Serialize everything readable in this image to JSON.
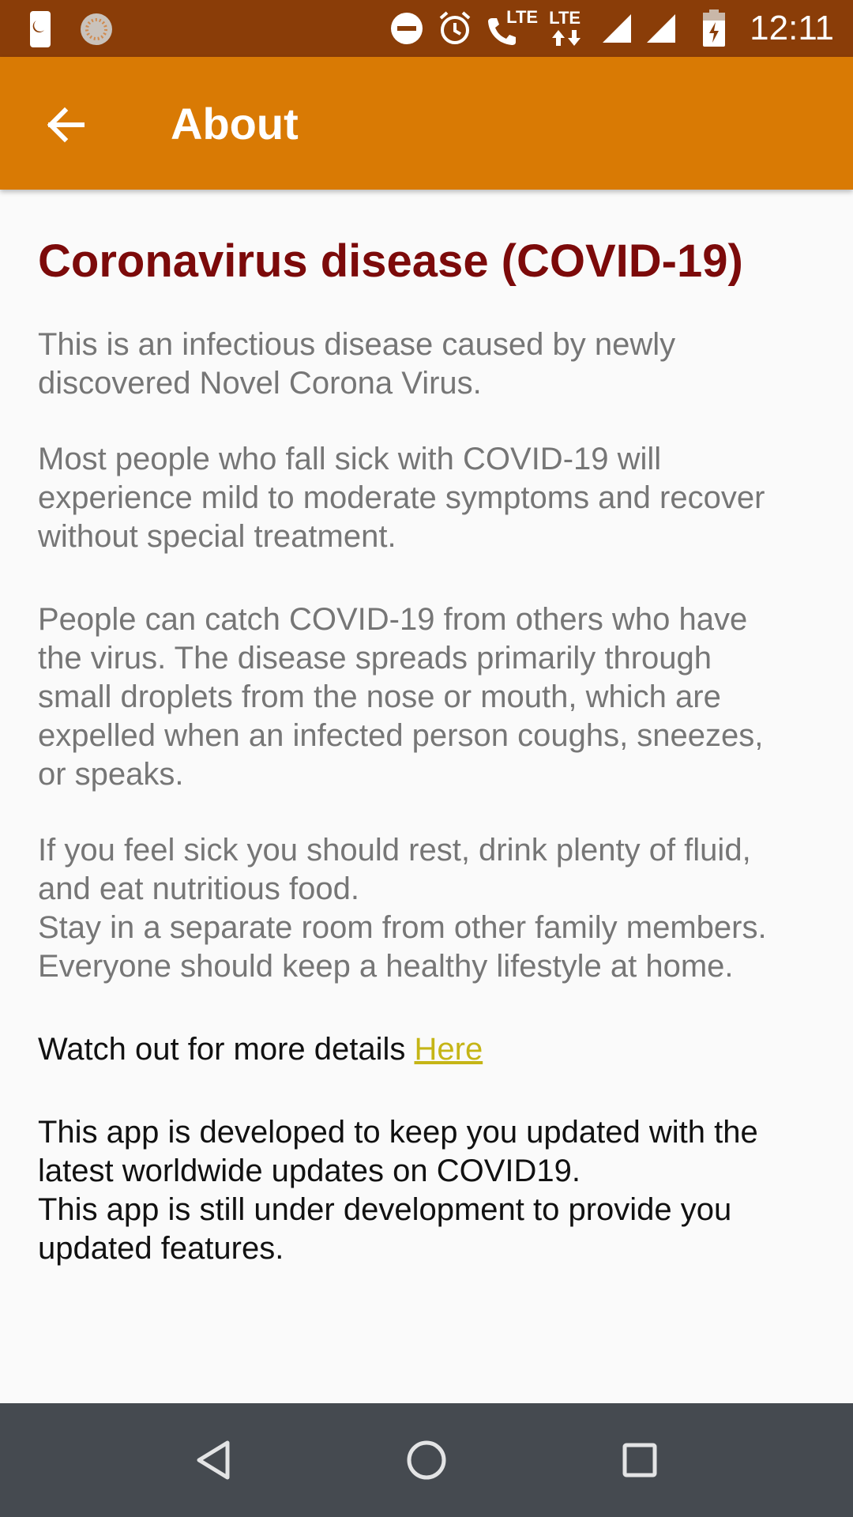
{
  "status_bar": {
    "time": "12:11",
    "lte_1": "LTE",
    "lte_2": "LTE",
    "icons": [
      "sim-icon",
      "app-icon",
      "do-not-disturb-icon",
      "alarm-icon",
      "call-icon",
      "signal-icon",
      "battery-icon"
    ]
  },
  "app_bar": {
    "title": "About",
    "back_icon": "arrow-back-icon",
    "color": "#d97a04"
  },
  "content": {
    "heading": "Coronavirus disease (COVID-19)",
    "p1": "This is an infectious disease caused by newly\ndiscovered Novel Corona Virus.",
    "p2": "Most people who fall sick with COVID-19 will\nexperience mild to moderate symptoms and recover\nwithout special treatment.",
    "p3": "People can catch COVID-19 from others who have\nthe virus. The disease spreads primarily through\nsmall droplets from the nose or mouth, which are\nexpelled when an infected person coughs, sneezes,\nor speaks.",
    "p4": "If you feel sick you should rest, drink plenty of fluid,\nand eat nutritious food.\nStay in a separate room from other family members.\nEveryone should keep a healthy lifestyle at home.",
    "watch_text": "Watch out for more details ",
    "watch_link": "Here",
    "p5": "This app is developed to keep you updated with the\nlatest worldwide updates on COVID19.\nThis app is still under development to provide you\nupdated features."
  },
  "colors": {
    "status_bar": "#8a3d08",
    "heading": "#7c0a0a",
    "link": "#c5b516",
    "nav_bar": "#454a50"
  },
  "nav_bar": {
    "buttons": [
      "back-triangle-icon",
      "home-circle-icon",
      "recents-square-icon"
    ]
  }
}
